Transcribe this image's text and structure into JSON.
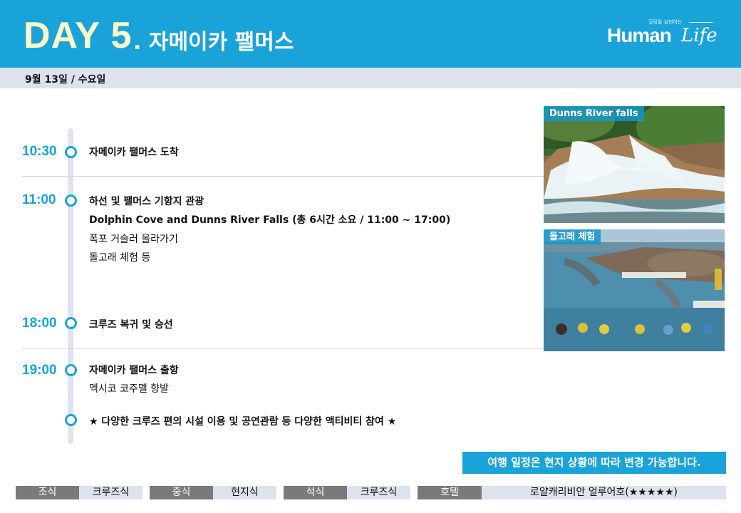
{
  "header": {
    "day": "DAY  5",
    "title": ". 자메이카 팰머스",
    "brand": {
      "tagline": "힐링을 실현하는",
      "name": "Human",
      "script": "Life"
    },
    "date": "9월 13일 / 수요일"
  },
  "schedule": [
    {
      "time": "10:30",
      "lines": [
        "자메이카 팰머스 도착"
      ]
    },
    {
      "time": "11:00",
      "lines": [
        "하선 및 팰머스 기항지 관광",
        "Dolphin Cove and Dunns River Falls (총 6시간 소요 / 11:00 ~ 17:00)",
        "폭포 거슬러 올라가기",
        "돌고래 체험 등"
      ]
    },
    {
      "time": "18:00",
      "lines": [
        "크루즈 복귀 및 승선"
      ]
    },
    {
      "time": "19:00",
      "lines": [
        "자메이카 팰머스 출항",
        "멕시코 코주멜 향발"
      ]
    },
    {
      "time": "",
      "lines": [
        "★ 다양한 크루즈 편의 시설 이용 및 공연관람 등 다양한 액티비티 참여 ★"
      ]
    }
  ],
  "photos": [
    {
      "caption": "Dunns River falls",
      "icon": "waterfall-photo"
    },
    {
      "caption": "돌고래 체험",
      "icon": "dolphin-photo"
    }
  ],
  "notice": "여행 일정은 현지 상황에 따라 변경 가능합니다.",
  "meals": [
    {
      "label": "조식",
      "value": "크루즈식"
    },
    {
      "label": "중식",
      "value": "현지식"
    },
    {
      "label": "석식",
      "value": "크루즈식"
    },
    {
      "label": "호텔",
      "value": "로얄캐리비안 얼루어호(★★★★★)"
    }
  ],
  "colors": {
    "accent": "#1aa3d9",
    "day_text": "#fffac8",
    "bar": "#dde3ee",
    "meal_label": "#7a7a7a"
  }
}
